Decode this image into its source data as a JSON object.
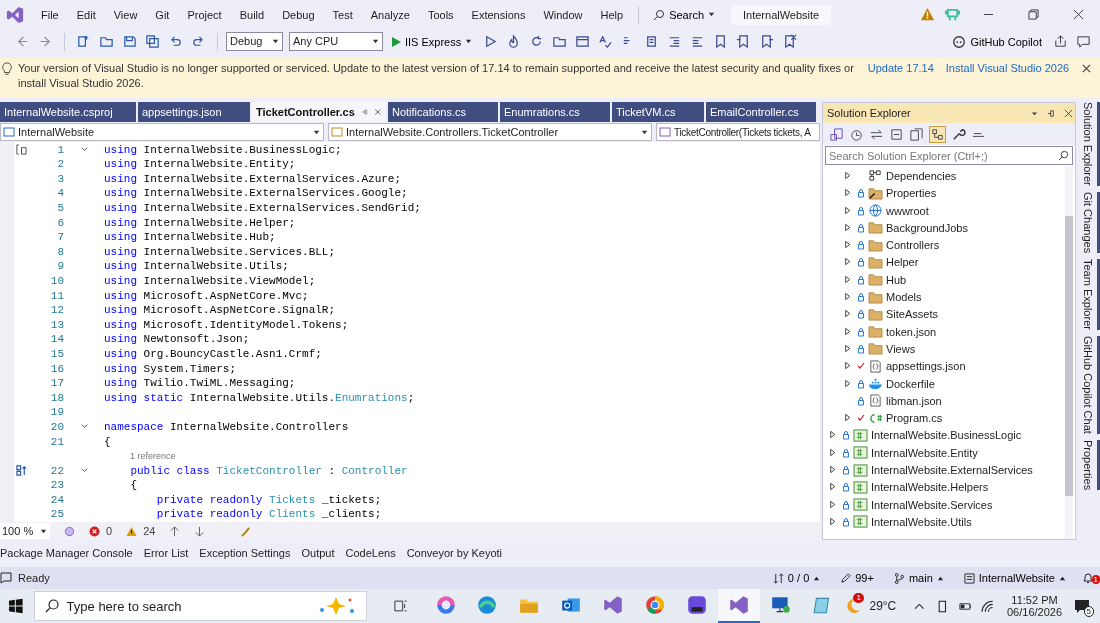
{
  "window": {
    "title": "InternalWebsite",
    "search": "Search"
  },
  "menu": [
    "File",
    "Edit",
    "View",
    "Git",
    "Project",
    "Build",
    "Debug",
    "Test",
    "Analyze",
    "Tools",
    "Extensions",
    "Window",
    "Help"
  ],
  "toolbar": {
    "configuration": "Debug",
    "platform": "Any CPU",
    "run_target": "IIS Express",
    "copilot": "GitHub Copilot"
  },
  "info_bar": {
    "message": "Your version of Visual Studio is no longer supported or serviced. Update to the latest version of 17.14 to remain supported and receive the latest security and quality fixes or install Visual Studio 2026.",
    "links": [
      "Update 17.14",
      "Install Visual Studio 2026"
    ]
  },
  "tabs": [
    {
      "label": "InternalWebsite.csproj",
      "selected": false
    },
    {
      "label": "appsettings.json",
      "selected": false
    },
    {
      "label": "TicketController.cs",
      "selected": true
    },
    {
      "label": "Notifications.cs",
      "selected": false
    },
    {
      "label": "Enumrations.cs",
      "selected": false
    },
    {
      "label": "TicketVM.cs",
      "selected": false
    },
    {
      "label": "EmailController.cs",
      "selected": false
    }
  ],
  "nav_bar": [
    "InternalWebsite",
    "InternalWebsite.Controllers.TicketController",
    "TicketController(Tickets tickets, A"
  ],
  "code": [
    {
      "kind": "code",
      "number": "1",
      "fold": true,
      "tokens": [
        {
          "text": "using",
          "kind": "keyword"
        },
        {
          "text": " InternalWebsite.BusinessLogic;",
          "kind": "plain"
        }
      ]
    },
    {
      "kind": "code",
      "number": "2",
      "fold": false,
      "tokens": [
        {
          "text": "using",
          "kind": "keyword"
        },
        {
          "text": " InternalWebsite.Entity;",
          "kind": "plain"
        }
      ]
    },
    {
      "kind": "code",
      "number": "3",
      "fold": false,
      "tokens": [
        {
          "text": "using",
          "kind": "keyword"
        },
        {
          "text": " InternalWebsite.ExternalServices.Azure;",
          "kind": "plain"
        }
      ]
    },
    {
      "kind": "code",
      "number": "4",
      "fold": false,
      "tokens": [
        {
          "text": "using",
          "kind": "keyword"
        },
        {
          "text": " InternalWebsite.ExternalServices.Google;",
          "kind": "plain"
        }
      ]
    },
    {
      "kind": "code",
      "number": "5",
      "fold": false,
      "tokens": [
        {
          "text": "using",
          "kind": "keyword"
        },
        {
          "text": " InternalWebsite.ExternalServices.SendGrid;",
          "kind": "plain"
        }
      ]
    },
    {
      "kind": "code",
      "number": "6",
      "fold": false,
      "tokens": [
        {
          "text": "using",
          "kind": "keyword"
        },
        {
          "text": " InternalWebsite.Helper;",
          "kind": "plain"
        }
      ]
    },
    {
      "kind": "code",
      "number": "7",
      "fold": false,
      "tokens": [
        {
          "text": "using",
          "kind": "keyword"
        },
        {
          "text": " InternalWebsite.Hub;",
          "kind": "plain"
        }
      ]
    },
    {
      "kind": "code",
      "number": "8",
      "fold": false,
      "tokens": [
        {
          "text": "using",
          "kind": "keyword"
        },
        {
          "text": " InternalWebsite.Services.BLL;",
          "kind": "plain"
        }
      ]
    },
    {
      "kind": "code",
      "number": "9",
      "fold": false,
      "tokens": [
        {
          "text": "using",
          "kind": "keyword"
        },
        {
          "text": " InternalWebsite.Utils;",
          "kind": "plain"
        }
      ]
    },
    {
      "kind": "code",
      "number": "10",
      "fold": false,
      "tokens": [
        {
          "text": "using",
          "kind": "keyword"
        },
        {
          "text": " InternalWebsite.ViewModel;",
          "kind": "plain"
        }
      ]
    },
    {
      "kind": "code",
      "number": "11",
      "fold": false,
      "tokens": [
        {
          "text": "using",
          "kind": "keyword"
        },
        {
          "text": " Microsoft.AspNetCore.Mvc;",
          "kind": "plain"
        }
      ]
    },
    {
      "kind": "code",
      "number": "12",
      "fold": false,
      "tokens": [
        {
          "text": "using",
          "kind": "keyword"
        },
        {
          "text": " Microsoft.AspNetCore.SignalR;",
          "kind": "plain"
        }
      ]
    },
    {
      "kind": "code",
      "number": "13",
      "fold": false,
      "tokens": [
        {
          "text": "using",
          "kind": "keyword"
        },
        {
          "text": " Microsoft.IdentityModel.Tokens;",
          "kind": "plain"
        }
      ]
    },
    {
      "kind": "code",
      "number": "14",
      "fold": false,
      "tokens": [
        {
          "text": "using",
          "kind": "keyword"
        },
        {
          "text": " Newtonsoft.Json;",
          "kind": "plain"
        }
      ]
    },
    {
      "kind": "code",
      "number": "15",
      "fold": false,
      "tokens": [
        {
          "text": "using",
          "kind": "keyword"
        },
        {
          "text": " Org.BouncyCastle.Asn1.Crmf;",
          "kind": "plain"
        }
      ]
    },
    {
      "kind": "code",
      "number": "16",
      "fold": false,
      "tokens": [
        {
          "text": "using",
          "kind": "keyword"
        },
        {
          "text": " System.Timers;",
          "kind": "plain"
        }
      ]
    },
    {
      "kind": "code",
      "number": "17",
      "fold": false,
      "tokens": [
        {
          "text": "using",
          "kind": "keyword"
        },
        {
          "text": " Twilio.TwiML.Messaging;",
          "kind": "plain"
        }
      ]
    },
    {
      "kind": "code",
      "number": "18",
      "fold": false,
      "tokens": [
        {
          "text": "using",
          "kind": "keyword"
        },
        {
          "text": " static",
          "kind": "keyword"
        },
        {
          "text": " InternalWebsite.Utils.",
          "kind": "plain"
        },
        {
          "text": "Enumrations",
          "kind": "type"
        },
        {
          "text": ";",
          "kind": "plain"
        }
      ]
    },
    {
      "kind": "code",
      "number": "19",
      "fold": false
    },
    {
      "kind": "code",
      "number": "20",
      "fold": true,
      "tokens": [
        {
          "text": "namespace",
          "kind": "keyword"
        },
        {
          "text": " InternalWebsite.Controllers",
          "kind": "plain"
        }
      ]
    },
    {
      "kind": "code",
      "number": "21",
      "fold": false,
      "tokens": [
        {
          "text": "{",
          "kind": "plain"
        }
      ]
    },
    {
      "kind": "lens",
      "text": "1 reference"
    },
    {
      "kind": "code",
      "number": "22",
      "fold": true,
      "tokens": [
        {
          "text": "    public",
          "kind": "keyword"
        },
        {
          "text": " class",
          "kind": "keyword"
        },
        {
          "text": " TicketController",
          "kind": "type"
        },
        {
          "text": " : ",
          "kind": "plain"
        },
        {
          "text": "Controller",
          "kind": "type"
        }
      ]
    },
    {
      "kind": "code",
      "number": "23",
      "fold": false,
      "tokens": [
        {
          "text": "    {",
          "kind": "plain"
        }
      ]
    },
    {
      "kind": "code",
      "number": "24",
      "fold": false,
      "tokens": [
        {
          "text": "        private",
          "kind": "keyword"
        },
        {
          "text": " readonly",
          "kind": "keyword"
        },
        {
          "text": " Tickets",
          "kind": "type"
        },
        {
          "text": " _tickets;",
          "kind": "plain"
        }
      ]
    },
    {
      "kind": "code",
      "number": "25",
      "fold": false,
      "tokens": [
        {
          "text": "        private",
          "kind": "keyword"
        },
        {
          "text": " readonly",
          "kind": "keyword"
        },
        {
          "text": " Clients",
          "kind": "type"
        },
        {
          "text": " _clients;",
          "kind": "plain"
        }
      ]
    }
  ],
  "editor_status": {
    "zoom": "100 %",
    "errors": "0",
    "warnings": "24"
  },
  "solution_explorer": {
    "title": "Solution Explorer",
    "search_placeholder": "Search Solution Explorer (Ctrl+;)",
    "project_items": [
      {
        "label": "Dependencies",
        "kind": "dependencies",
        "locked": false,
        "modified": false,
        "expandable": true
      },
      {
        "label": "Properties",
        "kind": "properties",
        "locked": true,
        "modified": false,
        "expandable": true
      },
      {
        "label": "wwwroot",
        "kind": "web",
        "locked": true,
        "modified": false,
        "expandable": true
      },
      {
        "label": "BackgroundJobs",
        "kind": "folder",
        "locked": true,
        "modified": false,
        "expandable": true
      },
      {
        "label": "Controllers",
        "kind": "folder",
        "locked": true,
        "modified": false,
        "expandable": true
      },
      {
        "label": "Helper",
        "kind": "folder",
        "locked": true,
        "modified": false,
        "expandable": true
      },
      {
        "label": "Hub",
        "kind": "folder",
        "locked": true,
        "modified": false,
        "expandable": true
      },
      {
        "label": "Models",
        "kind": "folder",
        "locked": true,
        "modified": false,
        "expandable": true
      },
      {
        "label": "SiteAssets",
        "kind": "folder",
        "locked": true,
        "modified": false,
        "expandable": true
      },
      {
        "label": "token.json",
        "kind": "folder",
        "locked": true,
        "modified": false,
        "expandable": true
      },
      {
        "label": "Views",
        "kind": "folder",
        "locked": true,
        "modified": false,
        "expandable": true
      },
      {
        "label": "appsettings.json",
        "kind": "json",
        "locked": false,
        "modified": true,
        "expandable": true
      },
      {
        "label": "Dockerfile",
        "kind": "docker",
        "locked": true,
        "modified": false,
        "expandable": true
      },
      {
        "label": "libman.json",
        "kind": "json",
        "locked": true,
        "modified": false,
        "expandable": false
      },
      {
        "label": "Program.cs",
        "kind": "csharp",
        "locked": false,
        "modified": true,
        "expandable": true
      }
    ],
    "projects": [
      {
        "label": "InternalWebsite.BusinessLogic",
        "kind": "project",
        "locked": true,
        "modified": false,
        "expandable": true
      },
      {
        "label": "InternalWebsite.Entity",
        "kind": "project",
        "locked": true,
        "modified": false,
        "expandable": true
      },
      {
        "label": "InternalWebsite.ExternalServices",
        "kind": "project",
        "locked": true,
        "modified": false,
        "expandable": true
      },
      {
        "label": "InternalWebsite.Helpers",
        "kind": "project",
        "locked": true,
        "modified": false,
        "expandable": true
      },
      {
        "label": "InternalWebsite.Services",
        "kind": "project",
        "locked": true,
        "modified": false,
        "expandable": true
      },
      {
        "label": "InternalWebsite.Utils",
        "kind": "project",
        "locked": true,
        "modified": false,
        "expandable": true
      }
    ]
  },
  "side_tabs": [
    "Solution Explorer",
    "Git Changes",
    "Team Explorer",
    "GitHub Copilot Chat",
    "Properties"
  ],
  "tool_tabs": [
    "Package Manager Console",
    "Error List",
    "Exception Settings",
    "Output",
    "CodeLens",
    "Conveyor by Keyoti"
  ],
  "status_bar": {
    "state": "Ready",
    "changes": "0 / 0",
    "edits": "99+",
    "branch": "main",
    "repo": "InternalWebsite",
    "notifications": "1"
  },
  "taskbar": {
    "search_placeholder": "Type here to search",
    "apps": [
      {
        "kind": "swirl",
        "selected": false
      },
      {
        "kind": "wave",
        "selected": false
      },
      {
        "kind": "folder",
        "selected": false
      },
      {
        "kind": "mail",
        "selected": false
      },
      {
        "kind": "loop",
        "selected": false
      },
      {
        "kind": "circle",
        "selected": false
      },
      {
        "kind": "tiles",
        "selected": false
      },
      {
        "kind": "loop",
        "selected": true
      },
      {
        "kind": "monitor",
        "selected": false
      },
      {
        "kind": "notepad",
        "selected": false
      }
    ],
    "weather_badge": "1",
    "weather": "29°C",
    "time": "11:52 PM",
    "date": "06/16/2026",
    "notifications": "5"
  }
}
